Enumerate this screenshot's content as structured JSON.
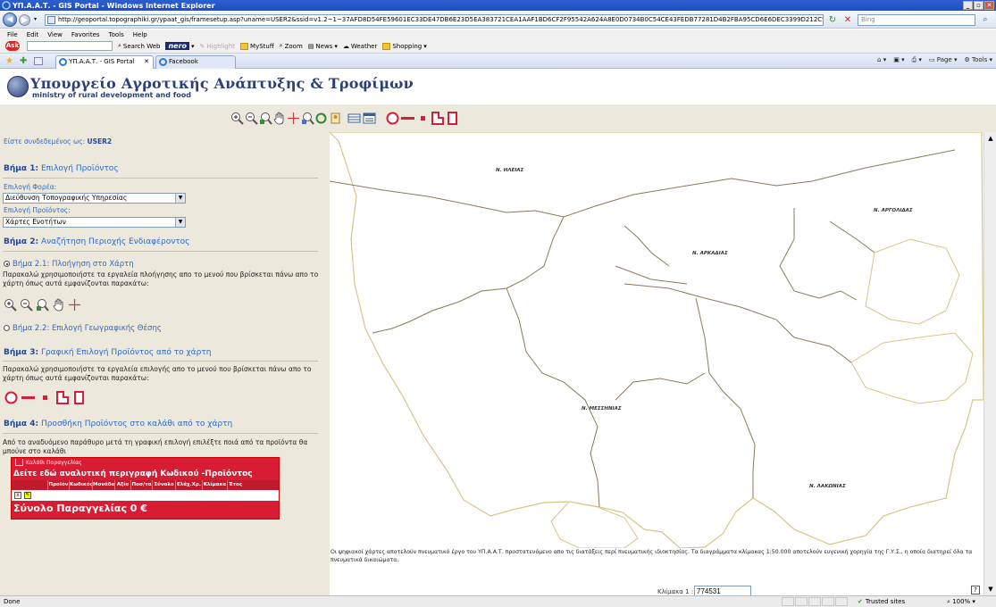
{
  "browser": {
    "title": "ΥΠ.Α.Α.Τ. - GIS Portal - Windows Internet Explorer",
    "url": "http://geoportal.topographiki.gr/ypaat_gis/framesetup.asp?uname=USER2&ssid=v1.2~1~37AFD8D54FE59601EC33DE47DB6E23D5EA383721CEA1AAF1BD6CF2F95542A624A8E0D0734B0C54CE43FEDB77281D4B2FBA95CD6E6DEC3399D212C9A19CDE4D01F0(",
    "search_placeholder": "Bing",
    "menu": [
      "File",
      "Edit",
      "View",
      "Favorites",
      "Tools",
      "Help"
    ],
    "toolbar": {
      "ask_logo": "Ask",
      "search_web": "Search Web",
      "nero": "nero",
      "highlight": "Highlight",
      "mystuff": "MyStuff",
      "zoom": "Zoom",
      "news": "News",
      "weather": "Weather",
      "shopping": "Shopping"
    },
    "tabs": [
      {
        "label": "ΥΠ.Α.Α.Τ. - GIS Portal",
        "active": true
      },
      {
        "label": "Facebook",
        "active": false
      }
    ],
    "commands": {
      "page": "Page",
      "tools": "Tools"
    },
    "status": {
      "done": "Done",
      "zone": "Trusted sites",
      "zoom": "100%"
    }
  },
  "header": {
    "title": "Υπουργείο Αγροτικής Ανάπτυξης & Τροφίμων",
    "subtitle": "ministry of rural development and food"
  },
  "map_tools": [
    "zoom-in-icon",
    "zoom-out-icon",
    "zoom-area-icon",
    "pan-hand-icon",
    "center-cross-icon",
    "zoom-layer-icon",
    "refresh-map-icon",
    "identify-icon",
    "layers-icon",
    "legend-icon",
    "select-circle-icon",
    "select-line-icon",
    "select-point-icon",
    "select-polygon-icon",
    "select-rectangle-icon"
  ],
  "sidebar": {
    "logged_in_label": "Είστε συνδεδεμένος ως:",
    "logged_in_user": "USER2",
    "step1": {
      "prefix": "Βήμα 1:",
      "title": "Επιλογή Προϊόντος",
      "carrier_label": "Επιλογή Φορέα:",
      "carrier_value": "Διεύθυνση Τοπογραφικής Υπηρεσίας",
      "product_label": "Επιλογή Προϊόντος:",
      "product_value": "Χάρτες Ενοτήτων"
    },
    "step2": {
      "prefix": "Βήμα 2:",
      "title": "Αναζήτηση Περιοχής Ενδιαφέροντος",
      "option1": "Βήμα 2.1: Πλοήγηση στο Χάρτη",
      "option1_desc_1": "Παρακαλώ χρησιμοποιήστε τα εργαλεία πλοήγησης απο το μενού που βρίσκεται πάνω απο το",
      "option1_desc_2": "χάρτη όπως αυτά εμφανίζονται παρακάτω:",
      "option2": "Βήμα 2.2: Επιλογή Γεωγραφικής Θέσης"
    },
    "step3": {
      "prefix": "Βήμα 3:",
      "title": "Γραφική Επιλογή Προϊόντος από το χάρτη",
      "desc_1": "Παρακαλώ χρησιμοποιήστε τα εργαλεία επιλογής απο το μενού που βρίσκεται πάνω απο το",
      "desc_2": "χάρτη όπως αυτά εμφανίζονται παρακάτω:"
    },
    "step4": {
      "prefix": "Βήμα 4:",
      "title": "Προσθήκη Προϊόντος στο καλάθι από το χάρτη",
      "desc_1": "Από το αναδυόμενο παράθυρο μετά τη γραφική επιλογή επιλέξτε ποιά από τα προϊόντα θα",
      "desc_2": "μπούνε στο καλάθι"
    },
    "cart": {
      "title": "Καλάθι Παραγγελίας",
      "details_link": "Δείτε εδώ αναλυτική περιγραφή Κωδικού -Προϊόντος",
      "columns": [
        "Προϊόν",
        "Κωδικός",
        "Μονάδα",
        "Αξία",
        "Ποσ/τα",
        "Σύνολο",
        "Ελάχ.Χρ.",
        "Κλίμακα",
        "Έτος"
      ],
      "total": "Σύνολο Παραγγελίας 0 €"
    }
  },
  "map": {
    "labels": [
      "Ν. ΗΛΕΙΑΣ",
      "Ν. ΑΡΓΟΛΙΔΑΣ",
      "Ν. ΑΡΚΑΔΙΑΣ",
      "Ν. ΜΕΣΣΗΝΙΑΣ",
      "Ν. ΛΑΚΩΝΙΑΣ"
    ],
    "caption": "Οι ψηφιακοί χάρτες αποτελούν πνευματικό έργο του ΥΠ.Α.Α.Τ. προστατευόμενο απο τις διατάξεις περί πνευματικής ιδιοκτησίας. Τα διαγράμματα κλίμακας 1:50.000 αποτελούν ευγενική χορηγία της Γ.Υ.Σ., η οποία διατηρεί όλα τα πνευματικά δικαιώματα.",
    "scale_label": "Κλίμακα  1 :",
    "scale_value": "774531",
    "help": "?",
    "colors": {
      "land_border": "#d9c98c",
      "district_border": "#8b7a5a",
      "sea": "#ffffff"
    }
  }
}
